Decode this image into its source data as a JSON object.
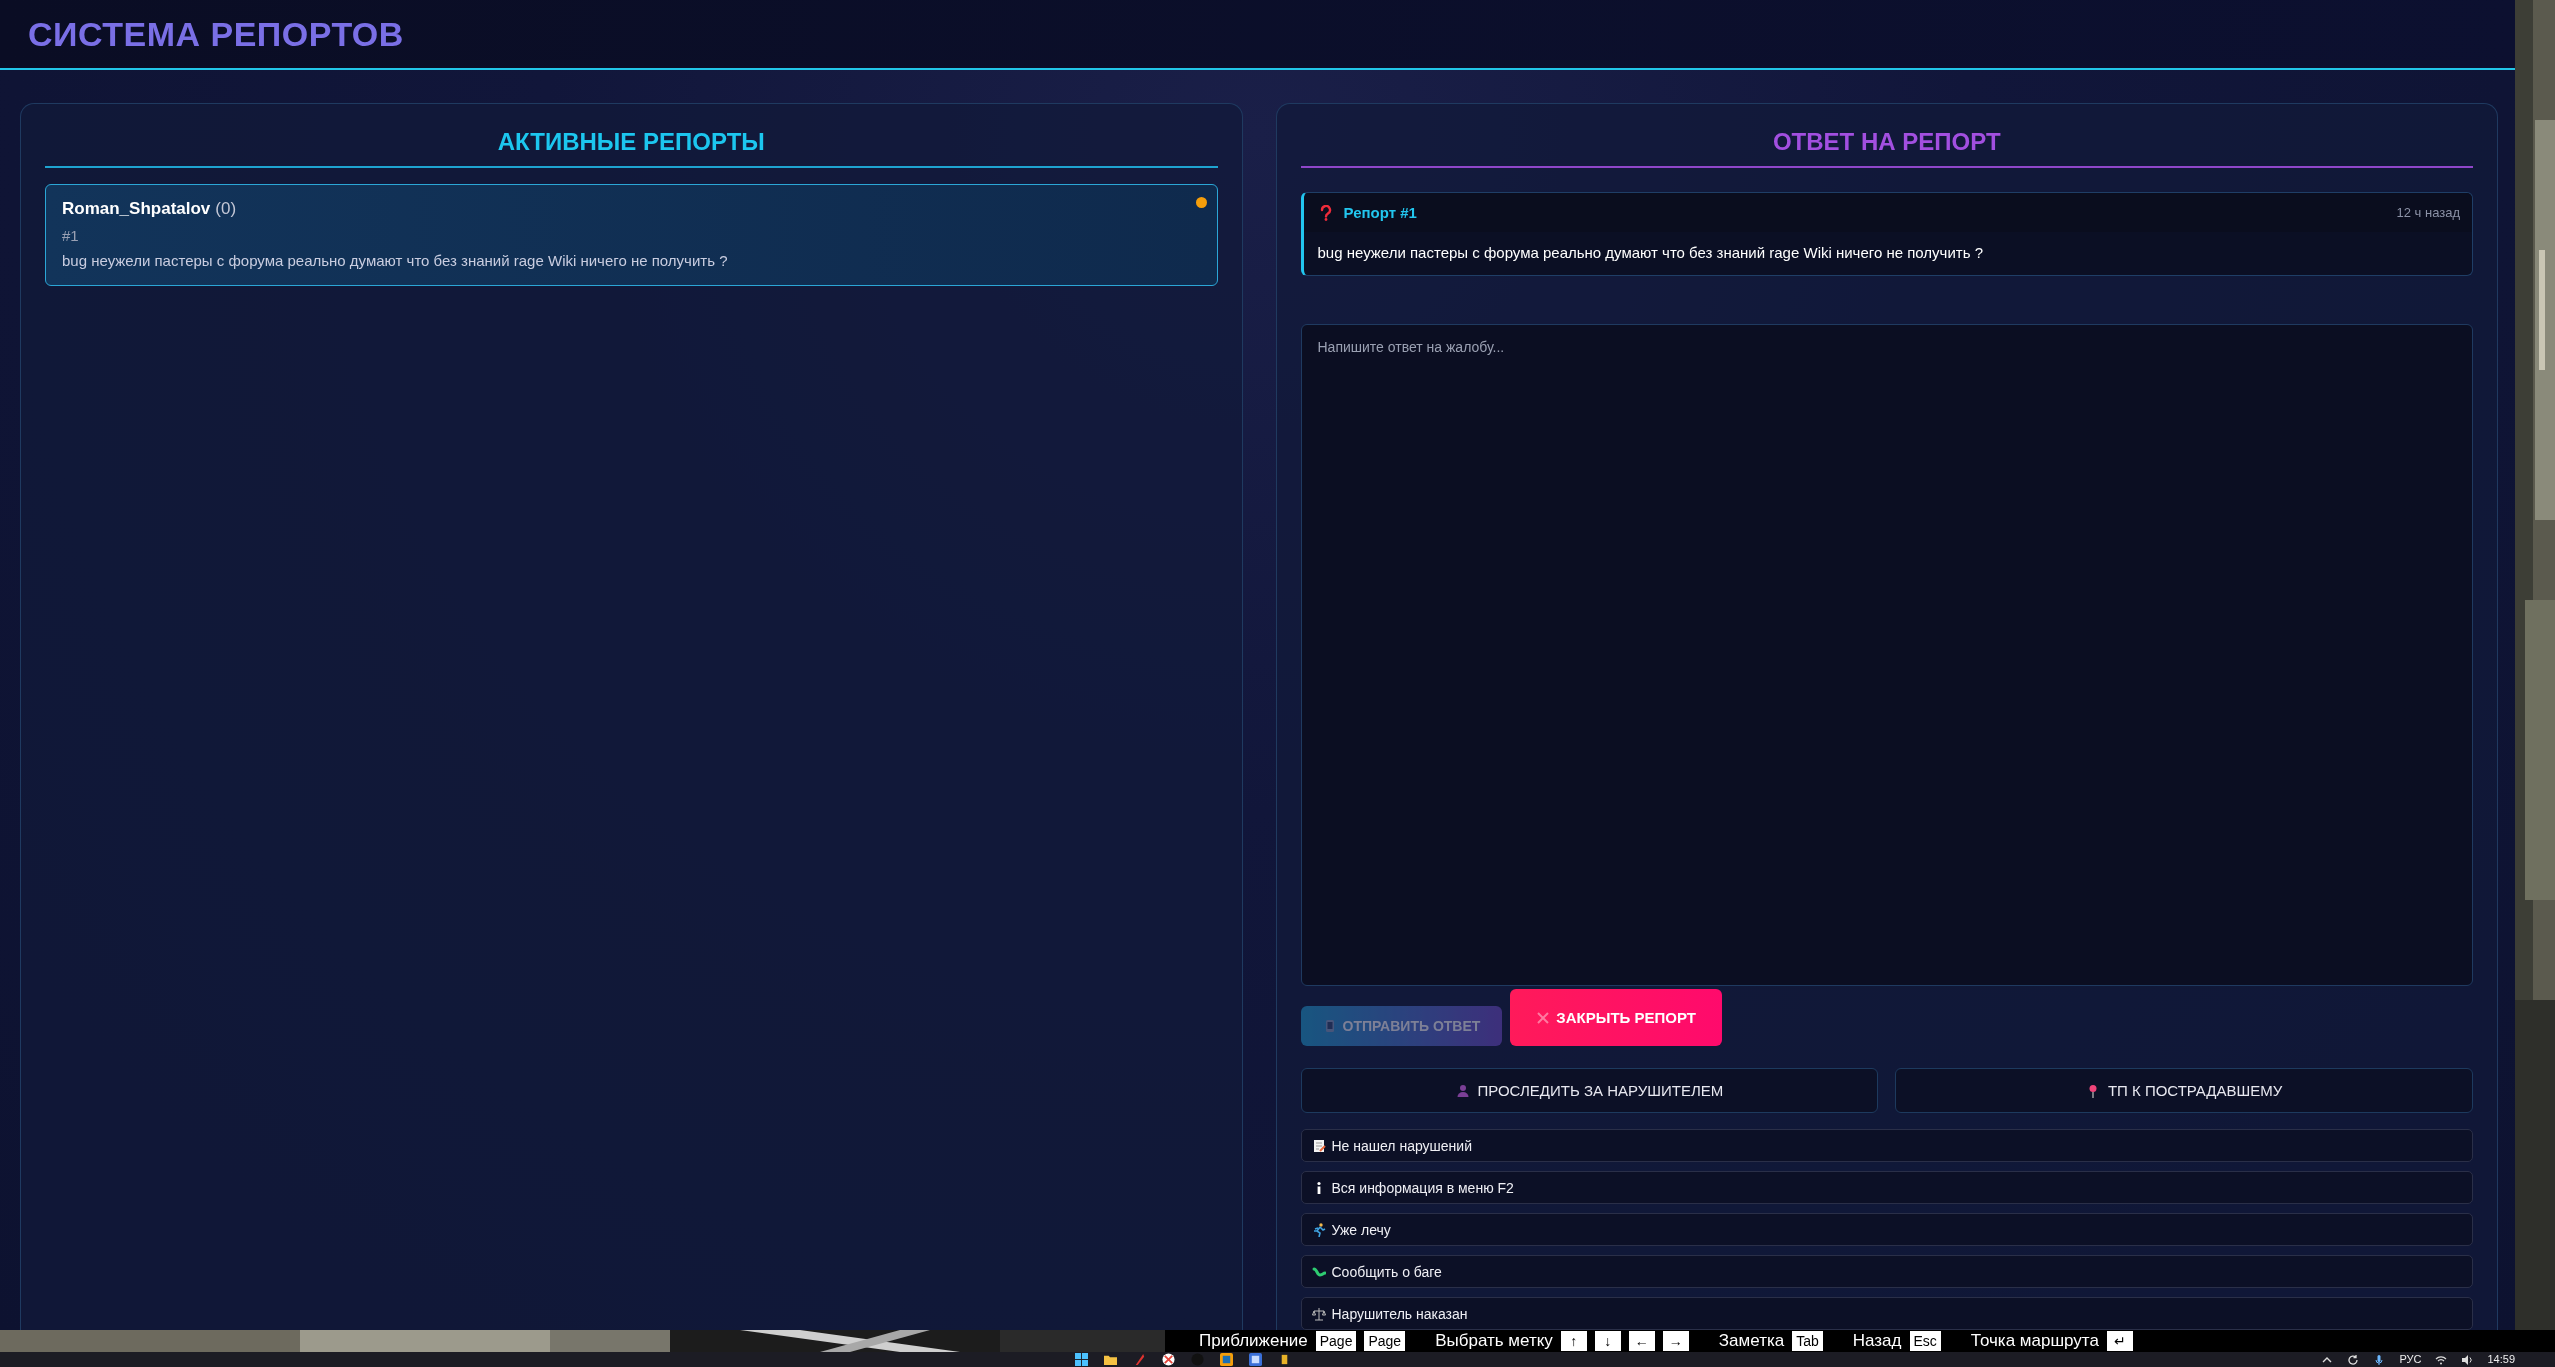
{
  "header": {
    "title": "СИСТЕМА РЕПОРТОВ"
  },
  "reports_panel": {
    "title": "АКТИВНЫЕ РЕПОРТЫ",
    "reports": [
      {
        "player": "Roman_Shpatalov",
        "count": "(0)",
        "number": "#1",
        "message": "bug неужели пастеры с форума реально думают что без знаний rage Wiki ничего не получить ?",
        "selected": true,
        "color": "#f59e0b"
      }
    ]
  },
  "reply_panel": {
    "title": "ОТВЕТ НА РЕПОРТ",
    "report": {
      "title": "Репорт #1",
      "time": "12 ч назад",
      "message": "bug неужели пастеры с форума реально думают что без знаний rage Wiki ничего не получить ?"
    },
    "reply_field": {
      "placeholder": "Напишите ответ на жалобу..."
    },
    "actions": [
      {
        "label": "ОТПРАВИТЬ ОТВЕТ",
        "kind": "send",
        "disabled": true
      },
      {
        "label": "ЗАКРЫТЬ РЕПОРТ",
        "kind": "close",
        "disabled": false
      }
    ],
    "player_actions": [
      {
        "label": "ПРОСЛЕДИТЬ ЗА НАРУШИТЕЛЕМ",
        "kind": "spectate"
      },
      {
        "label": "ТП К ПОСТРАДАВШЕМУ",
        "kind": "teleport"
      }
    ],
    "quick_replies": [
      {
        "label": "Не нашел нарушений",
        "kind": "memo"
      },
      {
        "label": "Вся информация в меню F2",
        "kind": "info"
      },
      {
        "label": "Уже лечу",
        "kind": "runner"
      },
      {
        "label": "Сообщить о баге",
        "kind": "bug"
      },
      {
        "label": "Нарушитель наказан",
        "kind": "scales"
      }
    ]
  },
  "map_hints": [
    {
      "label": "Приближение",
      "keys": [
        "Page",
        "Page"
      ]
    },
    {
      "label": "Выбрать метку",
      "keys": [
        "↑",
        "↓",
        "←",
        "→"
      ]
    },
    {
      "label": "Заметка",
      "keys": [
        "Tab"
      ]
    },
    {
      "label": "Назад",
      "keys": [
        "Esc"
      ]
    },
    {
      "label": "Точка маршрута",
      "keys": [
        "↵"
      ]
    }
  ],
  "taskbar": {
    "language": "РУС",
    "time": "14:59"
  }
}
